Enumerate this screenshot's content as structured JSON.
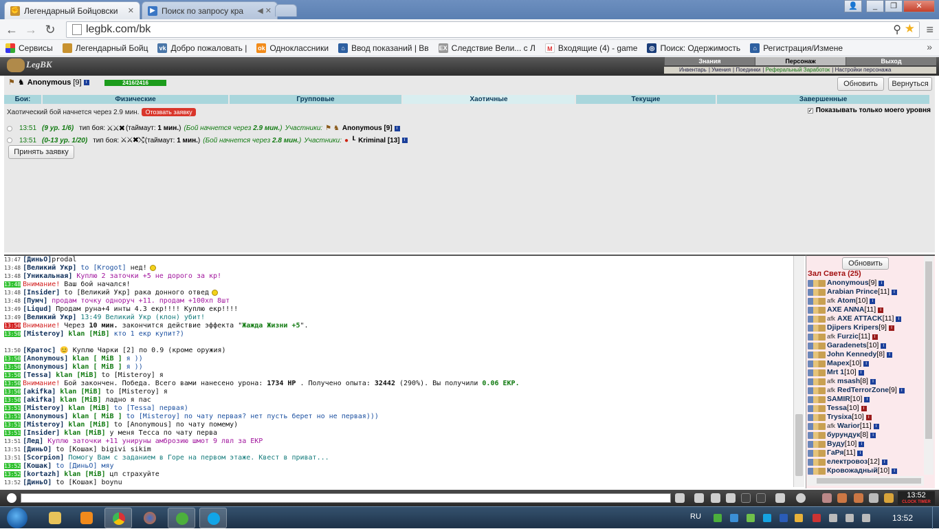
{
  "browser": {
    "tabs": [
      {
        "title": "Легендарный Бойцовски",
        "icon": "legbk-favicon",
        "active": true
      },
      {
        "title": "Поиск по запросу кра",
        "icon": "youtube-favicon",
        "active": false
      }
    ],
    "url": "legbk.com/bk",
    "bookmarks": [
      {
        "label": "Сервисы",
        "icon": "apps-icon"
      },
      {
        "label": "Легендарный Бойц",
        "icon": "legbk-favicon"
      },
      {
        "label": "Добро пожаловать |",
        "icon": "vk-icon"
      },
      {
        "label": "Одноклассники",
        "icon": "ok-icon"
      },
      {
        "label": "Ввод показаний | Вв",
        "icon": "home-icon"
      },
      {
        "label": "Следствие Вели... с Л",
        "icon": "ex-icon"
      },
      {
        "label": "Входящие (4) - game",
        "icon": "gmail-icon"
      },
      {
        "label": "Поиск: Одержимость",
        "icon": "search-site-icon"
      },
      {
        "label": "Регистрация/Измене",
        "icon": "home-icon"
      }
    ]
  },
  "game": {
    "logo": "LegBK",
    "topnav": {
      "tabs": [
        "Знания",
        "Персонаж",
        "Выход"
      ],
      "links": [
        "Инвентарь",
        "Умения",
        "Поединки",
        "Реферальный Заработок",
        "Настройки персонажа"
      ]
    },
    "character": {
      "name": "Anonymous",
      "level": "[9]",
      "hp": "2416/2416"
    },
    "buttons": {
      "refresh": "Обновить",
      "back": "Вернуться",
      "accept": "Принять заявку",
      "cancel": "Отозвать заявку",
      "refresh_online": "Обновить"
    },
    "battle_tabs": [
      "Бои:",
      "Физические",
      "Групповые",
      "Хаотичные",
      "Текущие",
      "Завершенные"
    ],
    "chaotic_msg": "Хаотический бой начнется через 2.9 мин.",
    "only_my_level": "Показывать только моего уровня",
    "battles": [
      {
        "time": "13:51",
        "levels": "(9 ур. 1/6)",
        "type_label": "тип боя:",
        "timeout_pre": "(таймаут:",
        "timeout": "1 мин.",
        "timeout_post": ")",
        "starts_pre": "(Бой начнется через",
        "starts": "2.9 мин.",
        "starts_post": ")",
        "participants_label": "Участники:",
        "participant": "Anonymous [9]"
      },
      {
        "time": "13:51",
        "levels": "(0-13 ур. 1/20)",
        "type_label": "тип боя:",
        "timeout_pre": "(таймаут:",
        "timeout": "1 мин.",
        "timeout_post": ")",
        "starts_pre": "(Бой начнется через",
        "starts": "2.8 мин.",
        "starts_post": ")",
        "participants_label": "Участники:",
        "participant": "Kriminal [13]"
      }
    ]
  },
  "chat": [
    {
      "t": "13:47",
      "tc": "",
      "parts": [
        [
          "n",
          "[ДиньО]"
        ],
        [
          "",
          ""
        ],
        [
          "",
          "prodal"
        ]
      ]
    },
    {
      "t": "13:48",
      "tc": "",
      "parts": [
        [
          "n",
          "[Великий Укр]"
        ],
        [
          "to",
          " to [Krogot]"
        ],
        [
          "",
          " нед!"
        ]
      ],
      "smile": true
    },
    {
      "t": "13:48",
      "tc": "",
      "parts": [
        [
          "n",
          "[Уникальная]"
        ],
        [
          "pm",
          " Куплю 2 заточки +5 не дорого за кр!"
        ]
      ]
    },
    {
      "t": "13:48",
      "tc": "hl",
      "parts": [
        [
          "att",
          "Внимание!"
        ],
        [
          "",
          " Ваш бой начался!"
        ]
      ]
    },
    {
      "t": "13:48",
      "tc": "",
      "parts": [
        [
          "n",
          "[Insider]"
        ],
        [
          "",
          " to [Великий Укр] рака донного отвед"
        ]
      ],
      "smile": true
    },
    {
      "t": "13:48",
      "tc": "",
      "parts": [
        [
          "n",
          "[Пумч]"
        ],
        [
          "pm",
          " продам точку одноруч +11. продам +100хп 8шт"
        ]
      ]
    },
    {
      "t": "13:49",
      "tc": "",
      "parts": [
        [
          "n",
          "[Liqud]"
        ],
        [
          "",
          " Продам руна+4 инты 4.3 екр!!!! Куплю екр!!!!"
        ]
      ]
    },
    {
      "t": "13:49",
      "tc": "",
      "parts": [
        [
          "n",
          "[Великий Укр]"
        ],
        [
          "tl",
          " 13:49 Великий Укр (клон) убит!"
        ]
      ]
    },
    {
      "t": "13:50",
      "tc": "red",
      "parts": [
        [
          "att",
          "Внимание!"
        ],
        [
          "",
          " Через "
        ],
        [
          "b",
          "10 мин."
        ],
        [
          "",
          " закончится действие эффекта \""
        ],
        [
          "k",
          "Жажда Жизни +5"
        ],
        [
          "",
          "\"."
        ]
      ]
    },
    {
      "t": "13:50",
      "tc": "hl",
      "parts": [
        [
          "n",
          "[Misteroy]"
        ],
        [
          "k",
          " klan [MiB]"
        ],
        [
          "to",
          " кто 1 екр купит?)"
        ]
      ]
    },
    {
      "t": "",
      "tc": "",
      "parts": [
        [
          "",
          ""
        ]
      ]
    },
    {
      "t": "13:50",
      "tc": "",
      "parts": [
        [
          "n",
          "[Кратос]"
        ],
        [
          "",
          " 😊   Куплю Чарки [2] по 0.9 (кроме оружия)"
        ]
      ]
    },
    {
      "t": "13:50",
      "tc": "hl",
      "parts": [
        [
          "n",
          "[Anonymous]"
        ],
        [
          "k",
          " klan [ MiB ]"
        ],
        [
          "to",
          " я ))"
        ]
      ]
    },
    {
      "t": "13:50",
      "tc": "hl",
      "parts": [
        [
          "n",
          "[Anonymous]"
        ],
        [
          "k",
          " klan [ MiB ]"
        ],
        [
          "to",
          " я ))"
        ]
      ]
    },
    {
      "t": "13:50",
      "tc": "hl",
      "parts": [
        [
          "n",
          "[Tessa]"
        ],
        [
          "k",
          " klan [MiB]"
        ],
        [
          "",
          " to [Misteroy] я"
        ]
      ]
    },
    {
      "t": "13:50",
      "tc": "hl",
      "parts": [
        [
          "att",
          "Внимание!"
        ],
        [
          "",
          " Бой закончен. Победа. Всего вами нанесено урона: "
        ],
        [
          "b",
          "1734 HP"
        ],
        [
          "",
          " . Получено опыта: "
        ],
        [
          "b",
          "32442"
        ],
        [
          "",
          " (290%). Вы получили "
        ],
        [
          "k",
          "0.06 EKP."
        ]
      ]
    },
    {
      "t": "13:50",
      "tc": "hl",
      "parts": [
        [
          "n",
          "[akifka]"
        ],
        [
          "k",
          " klan [MiB]"
        ],
        [
          "",
          " to [Misteroy] я"
        ]
      ]
    },
    {
      "t": "13:50",
      "tc": "hl",
      "parts": [
        [
          "n",
          "[akifka]"
        ],
        [
          "k",
          " klan [MiB]"
        ],
        [
          "",
          " ладно я пас"
        ]
      ]
    },
    {
      "t": "13:51",
      "tc": "hl",
      "parts": [
        [
          "n",
          "[Misteroy]"
        ],
        [
          "k",
          " klan [MiB]"
        ],
        [
          "to",
          " to [Tessa] первая)"
        ]
      ]
    },
    {
      "t": "13:51",
      "tc": "hl",
      "parts": [
        [
          "n",
          "[Anonymous]"
        ],
        [
          "k",
          " klan [ MiB ]"
        ],
        [
          "to",
          " to [Misteroy] по чату первая? нет пусть берет но не первая)))"
        ]
      ]
    },
    {
      "t": "13:51",
      "tc": "hl",
      "parts": [
        [
          "n",
          "[Misteroy]"
        ],
        [
          "k",
          " klan [MiB]"
        ],
        [
          "",
          " to [Anonymous] по чату помему)"
        ]
      ]
    },
    {
      "t": "13:51",
      "tc": "hl",
      "parts": [
        [
          "n",
          "[Insider]"
        ],
        [
          "k",
          " klan [MiB]"
        ],
        [
          "",
          " у меня Тесса по чату перва"
        ]
      ]
    },
    {
      "t": "13:51",
      "tc": "",
      "parts": [
        [
          "n",
          "[Лед]"
        ],
        [
          "pm",
          " Куплю заточки +11 унируны амброзию шмот 9 лвл за ЕКР"
        ]
      ]
    },
    {
      "t": "13:51",
      "tc": "",
      "parts": [
        [
          "n",
          "[ДиньО]"
        ],
        [
          "",
          " to [Кошак] bigivi sikim"
        ]
      ]
    },
    {
      "t": "13:51",
      "tc": "",
      "parts": [
        [
          "n",
          "[Scorpion]"
        ],
        [
          "tl",
          " Помогу Вам с заданием в Горе на первом этаже. Квест в приват..."
        ]
      ]
    },
    {
      "t": "13:52",
      "tc": "hl",
      "parts": [
        [
          "n",
          "[Кошак]"
        ],
        [
          "to",
          " to [ДиньО] мяу"
        ]
      ]
    },
    {
      "t": "13:52",
      "tc": "hl",
      "parts": [
        [
          "n",
          "[kortazh]"
        ],
        [
          "k",
          " klan [MiB]"
        ],
        [
          "",
          " цп страхуйте"
        ]
      ]
    },
    {
      "t": "13:52",
      "tc": "",
      "parts": [
        [
          "n",
          "[ДиньО]"
        ],
        [
          "",
          " to [Кошак] boynu"
        ]
      ]
    }
  ],
  "online": {
    "room": "Зал Света (25)",
    "users": [
      {
        "name": "Anonymous",
        "level": "[9]",
        "afk": false,
        "badge": "blue"
      },
      {
        "name": "Arabian Prince",
        "level": "[11]",
        "afk": false,
        "badge": "blue"
      },
      {
        "name": "Atom",
        "level": "[10]",
        "afk": true,
        "badge": "blue"
      },
      {
        "name": "AXE ANNA",
        "level": "[11]",
        "afk": false,
        "badge": "red"
      },
      {
        "name": "AXE ATTACK",
        "level": "[11]",
        "afk": true,
        "badge": "blue"
      },
      {
        "name": "Djipers Kripers",
        "level": "[9]",
        "afk": false,
        "badge": "red"
      },
      {
        "name": "Furzic",
        "level": "[11]",
        "afk": true,
        "badge": "red"
      },
      {
        "name": "Garadenets",
        "level": "[10]",
        "afk": false,
        "badge": "blue"
      },
      {
        "name": "John Kennedy",
        "level": "[8]",
        "afk": false,
        "badge": "blue"
      },
      {
        "name": "Mapex",
        "level": "[10]",
        "afk": false,
        "badge": "blue"
      },
      {
        "name": "Mrt 1",
        "level": "[10]",
        "afk": false,
        "badge": "blue"
      },
      {
        "name": "msash",
        "level": "[8]",
        "afk": true,
        "badge": "blue"
      },
      {
        "name": "RedTerrorZone",
        "level": "[9]",
        "afk": true,
        "badge": "blue"
      },
      {
        "name": "SAMIR",
        "level": "[10]",
        "afk": false,
        "badge": "blue"
      },
      {
        "name": "Tessa",
        "level": "[10]",
        "afk": false,
        "badge": "red"
      },
      {
        "name": "Trysixa",
        "level": "[10]",
        "afk": false,
        "badge": "red"
      },
      {
        "name": "Warior",
        "level": "[11]",
        "afk": true,
        "badge": "blue"
      },
      {
        "name": "бурундук",
        "level": "[8]",
        "afk": false,
        "badge": "blue"
      },
      {
        "name": "Вуду",
        "level": "[10]",
        "afk": false,
        "badge": "blue"
      },
      {
        "name": "ГаРя",
        "level": "[11]",
        "afk": false,
        "badge": "blue"
      },
      {
        "name": "електровоз",
        "level": "[12]",
        "afk": false,
        "badge": "blue"
      },
      {
        "name": "Кровожадный",
        "level": "[10]",
        "afk": false,
        "badge": "blue"
      }
    ]
  },
  "afk_label": "afk",
  "clock": {
    "time": "13:52",
    "sub": "CLOCK TIMER"
  },
  "taskbar": {
    "lang": "RU",
    "time": "13:52"
  }
}
